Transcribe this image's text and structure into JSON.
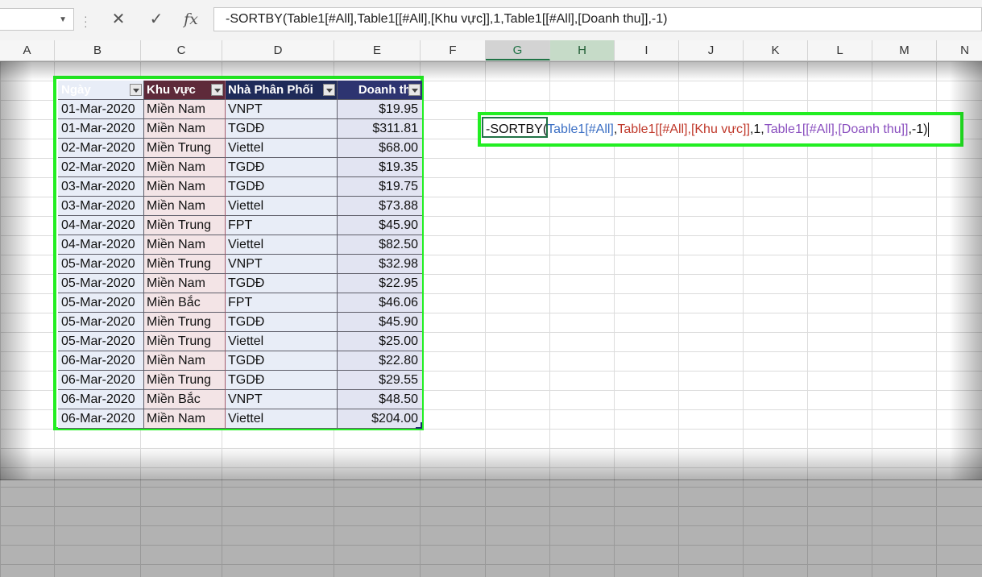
{
  "formula_bar": {
    "name_box": "",
    "cancel_icon": "✕",
    "enter_icon": "✓",
    "fx_label": "fx",
    "formula": "-SORTBY(Table1[#All],Table1[[#All],[Khu vực]],1,Table1[[#All],[Doanh thu]],-1)"
  },
  "columns": [
    "A",
    "B",
    "C",
    "D",
    "E",
    "F",
    "G",
    "H",
    "I",
    "J",
    "K",
    "L",
    "M",
    "N"
  ],
  "table": {
    "headers": [
      "Ngày",
      "Khu vực",
      "Nhà Phân Phối",
      "Doanh thu"
    ],
    "rows": [
      [
        "01-Mar-2020",
        "Miền Nam",
        "VNPT",
        "$19.95"
      ],
      [
        "01-Mar-2020",
        "Miền Nam",
        "TGDĐ",
        "$311.81"
      ],
      [
        "02-Mar-2020",
        "Miền Trung",
        "Viettel",
        "$68.00"
      ],
      [
        "02-Mar-2020",
        "Miền Nam",
        "TGDĐ",
        "$19.35"
      ],
      [
        "03-Mar-2020",
        "Miền Nam",
        "TGDĐ",
        "$19.75"
      ],
      [
        "03-Mar-2020",
        "Miền Nam",
        "Viettel",
        "$73.88"
      ],
      [
        "04-Mar-2020",
        "Miền Trung",
        "FPT",
        "$45.90"
      ],
      [
        "04-Mar-2020",
        "Miền Nam",
        "Viettel",
        "$82.50"
      ],
      [
        "05-Mar-2020",
        "Miền Trung",
        "VNPT",
        "$32.98"
      ],
      [
        "05-Mar-2020",
        "Miền Nam",
        "TGDĐ",
        "$22.95"
      ],
      [
        "05-Mar-2020",
        "Miền Bắc",
        "FPT",
        "$46.06"
      ],
      [
        "05-Mar-2020",
        "Miền Trung",
        "TGDĐ",
        "$45.90"
      ],
      [
        "05-Mar-2020",
        "Miền Trung",
        "Viettel",
        "$25.00"
      ],
      [
        "06-Mar-2020",
        "Miền Nam",
        "TGDĐ",
        "$22.80"
      ],
      [
        "06-Mar-2020",
        "Miền Trung",
        "TGDĐ",
        "$29.55"
      ],
      [
        "06-Mar-2020",
        "Miền Bắc",
        "VNPT",
        "$48.50"
      ],
      [
        "06-Mar-2020",
        "Miền Nam",
        "Viettel",
        "$204.00"
      ]
    ]
  },
  "cell_formula": {
    "prefix": "-SORTBY(",
    "arg1": "Table1[#All]",
    "sep1": ",",
    "arg2": "Table1[[#All],[Khu vực]]",
    "mid": ",1,",
    "arg3": "Table1[[#All],[Doanh thu]]",
    "suffix": ",-1)"
  },
  "colors": {
    "highlight_border": "#22ee22",
    "excel_green": "#217346",
    "header_navy": "#1d2b6b"
  }
}
